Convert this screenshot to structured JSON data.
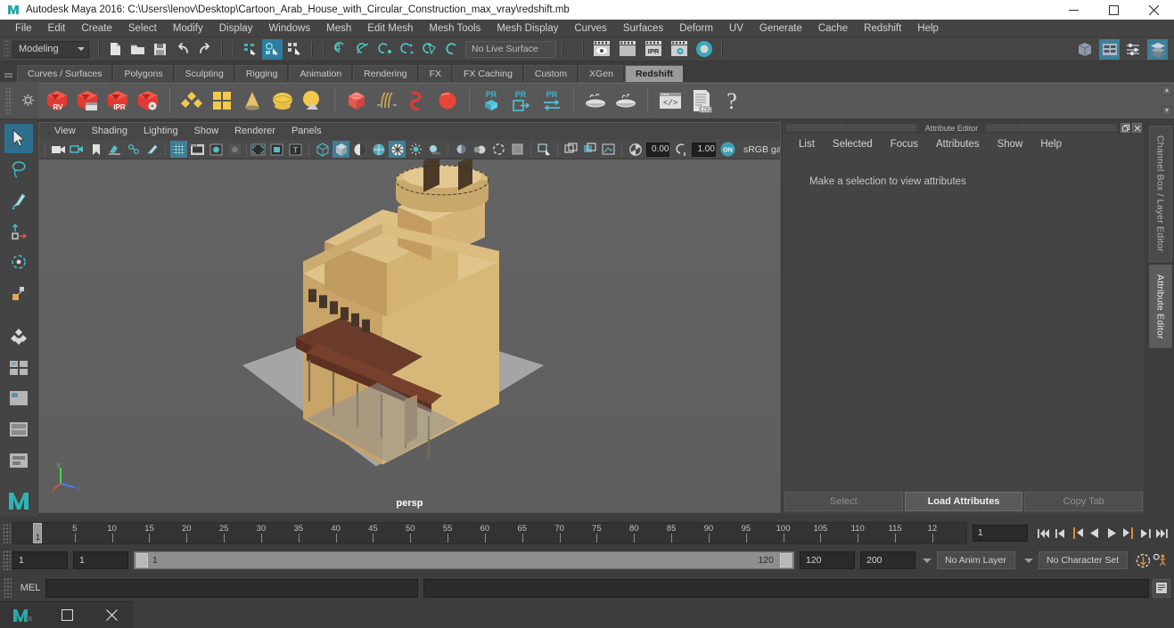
{
  "window": {
    "title": "Autodesk Maya 2016: C:\\Users\\lenov\\Desktop\\Cartoon_Arab_House_with_Circular_Construction_max_vray\\redshift.mb",
    "minimize": "─",
    "maximize": "❐",
    "close": "✕"
  },
  "menubar": {
    "items": [
      {
        "label": "File"
      },
      {
        "label": "Edit"
      },
      {
        "label": "Create"
      },
      {
        "label": "Select"
      },
      {
        "label": "Modify"
      },
      {
        "label": "Display"
      },
      {
        "label": "Windows"
      },
      {
        "label": "Mesh"
      },
      {
        "label": "Edit Mesh"
      },
      {
        "label": "Mesh Tools"
      },
      {
        "label": "Mesh Display"
      },
      {
        "label": "Curves"
      },
      {
        "label": "Surfaces"
      },
      {
        "label": "Deform"
      },
      {
        "label": "UV"
      },
      {
        "label": "Generate"
      },
      {
        "label": "Cache"
      },
      {
        "label": "Redshift"
      },
      {
        "label": "Help"
      }
    ]
  },
  "statusline": {
    "mode": "Modeling",
    "live_surface": "No Live Surface",
    "icons": {
      "new_scene": "new-scene-icon",
      "open_scene": "open-scene-icon",
      "save_scene": "save-scene-icon",
      "undo": "undo-icon",
      "redo": "redo-icon",
      "select_hierarchy": "select-by-hierarchy-icon",
      "select_object": "select-by-object-type-icon",
      "select_component": "select-by-component-type-icon",
      "snap_grid": "snap-to-grid-icon",
      "snap_curve": "snap-to-curve-icon",
      "snap_point": "snap-to-point-icon",
      "snap_projected": "snap-to-projected-center-icon",
      "snap_view_plane": "snap-to-view-plane-icon",
      "make_live": "make-live-icon",
      "render_current": "render-current-frame-icon",
      "render_sequence": "render-sequence-icon",
      "ipr_render": "ipr-render-icon",
      "render_settings": "render-settings-icon",
      "render_view": "render-view-icon",
      "show_hide_modeling": "toggle-modeling-editors-icon",
      "show_hide_attribute": "toggle-attribute-editor-icon",
      "show_hide_tool": "toggle-tool-settings-icon",
      "show_hide_channel": "toggle-channel-box-icon"
    }
  },
  "shelf": {
    "tabs": [
      {
        "label": "Curves / Surfaces",
        "active": false
      },
      {
        "label": "Polygons",
        "active": false
      },
      {
        "label": "Sculpting",
        "active": false
      },
      {
        "label": "Rigging",
        "active": false
      },
      {
        "label": "Animation",
        "active": false
      },
      {
        "label": "Rendering",
        "active": false
      },
      {
        "label": "FX",
        "active": false
      },
      {
        "label": "FX Caching",
        "active": false
      },
      {
        "label": "Custom",
        "active": false
      },
      {
        "label": "XGen",
        "active": false
      },
      {
        "label": "Redshift",
        "active": true
      }
    ],
    "buttons": [
      {
        "name": "redshift-render-view-icon",
        "badge": "RV"
      },
      {
        "name": "redshift-render-sequence-icon",
        "badge": ""
      },
      {
        "name": "redshift-ipr-icon",
        "badge": "IPR"
      },
      {
        "name": "redshift-render-settings-icon",
        "badge": ""
      },
      {
        "name": "redshift-material-icon",
        "badge": ""
      },
      {
        "name": "redshift-subsurface-icon",
        "badge": ""
      },
      {
        "name": "redshift-light-cone-icon",
        "badge": ""
      },
      {
        "name": "redshift-dome-light-icon",
        "badge": ""
      },
      {
        "name": "redshift-environment-icon",
        "badge": ""
      },
      {
        "name": "redshift-proxy-icon",
        "badge": ""
      },
      {
        "name": "redshift-hair-icon",
        "badge": ""
      },
      {
        "name": "redshift-curve-icon",
        "badge": ""
      },
      {
        "name": "redshift-sphere-icon",
        "badge": ""
      },
      {
        "name": "redshift-pr-object-icon",
        "badge": "PR"
      },
      {
        "name": "redshift-pr-export-icon",
        "badge": "PR"
      },
      {
        "name": "redshift-pr-transfer-icon",
        "badge": "PR"
      },
      {
        "name": "redshift-volume-icon",
        "badge": ""
      },
      {
        "name": "redshift-volume2-icon",
        "badge": ""
      },
      {
        "name": "redshift-script-editor-icon",
        "badge": ""
      },
      {
        "name": "redshift-log-icon",
        "badge": "LOG"
      },
      {
        "name": "redshift-help-icon",
        "badge": "?"
      }
    ]
  },
  "toolbox": {
    "tools": [
      {
        "name": "select-tool",
        "selected": true
      },
      {
        "name": "lasso-select-tool",
        "selected": false
      },
      {
        "name": "paint-select-tool",
        "selected": false
      },
      {
        "name": "move-tool",
        "selected": false
      },
      {
        "name": "rotate-tool",
        "selected": false
      },
      {
        "name": "scale-tool",
        "selected": false
      },
      {
        "name": "last-tool-used",
        "selected": false
      },
      {
        "name": "show-manipulator-tool",
        "selected": false
      },
      {
        "name": "single-perspective-layout",
        "selected": false
      },
      {
        "name": "four-view-layout",
        "selected": false
      },
      {
        "name": "persp-outliner-layout",
        "selected": false
      },
      {
        "name": "hypergraph-layout",
        "selected": false
      },
      {
        "name": "maya-logo",
        "selected": false
      }
    ]
  },
  "viewport": {
    "menus": [
      {
        "label": "View"
      },
      {
        "label": "Shading"
      },
      {
        "label": "Lighting"
      },
      {
        "label": "Show"
      },
      {
        "label": "Renderer"
      },
      {
        "label": "Panels"
      }
    ],
    "camera_label": "persp",
    "exposure": "0.00",
    "gamma_value": "1.00",
    "gamma_label": "sRGB gamma",
    "axis_labels": {
      "x": "x",
      "y": "y",
      "z": "z"
    },
    "toolbar_icons": [
      "select-camera-icon",
      "camera-attributes-icon",
      "bookmark-icon",
      "image-plane-icon",
      "two-d-pan-zoom-icon",
      "grease-pencil-icon",
      "grid-toggle-icon",
      "film-gate-icon",
      "resolution-gate-icon",
      "gate-mask-icon",
      "film-origin-icon",
      "safe-action-icon",
      "title-safe-icon",
      "wireframe-shading-icon",
      "smooth-shade-all-icon",
      "smooth-shade-flat-icon",
      "wireframe-on-shaded-icon",
      "textured-shading-icon",
      "use-default-light-icon",
      "shadows-icon",
      "screen-space-ao-icon",
      "motion-blur-icon",
      "multisample-icon",
      "isolate-select-icon",
      "xray-icon",
      "xray-joints-icon",
      "xray-active-components-icon",
      "exposure-icon",
      "gamma-icon",
      "color-management-toggle-icon"
    ]
  },
  "attribute_editor": {
    "panel_title": "Attribute Editor",
    "menus": [
      {
        "label": "List"
      },
      {
        "label": "Selected"
      },
      {
        "label": "Focus"
      },
      {
        "label": "Attributes"
      },
      {
        "label": "Show"
      },
      {
        "label": "Help"
      }
    ],
    "empty_message": "Make a selection to view attributes",
    "footer_buttons": [
      {
        "label": "Select",
        "primary": false
      },
      {
        "label": "Load Attributes",
        "primary": true
      },
      {
        "label": "Copy Tab",
        "primary": false
      }
    ],
    "undock_icon": "undock-icon",
    "close_icon": "close-icon"
  },
  "vertical_tabs": [
    {
      "label": "Channel Box / Layer Editor",
      "active": false
    },
    {
      "label": "Attribute Editor",
      "active": true
    }
  ],
  "timeline": {
    "tick_labels": [
      "5",
      "10",
      "15",
      "20",
      "25",
      "30",
      "35",
      "40",
      "45",
      "50",
      "55",
      "60",
      "65",
      "70",
      "75",
      "80",
      "85",
      "90",
      "95",
      "100",
      "105",
      "110",
      "115",
      "12"
    ],
    "start": 1,
    "end": 120,
    "current_frame": "1",
    "playhead_label": "1",
    "current_frame_field": "1",
    "playback_buttons": [
      {
        "name": "go-to-start-button",
        "glyph": "⏮"
      },
      {
        "name": "step-back-frame-button",
        "glyph": "⏴"
      },
      {
        "name": "step-back-key-button",
        "glyph": "⏴"
      },
      {
        "name": "play-backwards-button",
        "glyph": "◀"
      },
      {
        "name": "play-forwards-button",
        "glyph": "▶"
      },
      {
        "name": "step-forward-key-button",
        "glyph": "⏵"
      },
      {
        "name": "step-forward-frame-button",
        "glyph": "⏵"
      },
      {
        "name": "go-to-end-button",
        "glyph": "⏭"
      }
    ]
  },
  "range_slider": {
    "anim_start": "1",
    "playback_start": "1",
    "range_start_label": "1",
    "range_end_label": "120",
    "playback_end": "120",
    "anim_end": "200",
    "anim_layer": "No Anim Layer",
    "character_set": "No Character Set",
    "auto_key_icon": "auto-keyframe-icon",
    "anim_prefs_icon": "animation-preferences-icon"
  },
  "command_line": {
    "label": "MEL",
    "input_value": "",
    "output_value": "",
    "script_editor_icon": "script-editor-icon"
  },
  "taskbar": {
    "items": [
      {
        "name": "taskbar-maya-icon",
        "label": ""
      },
      {
        "name": "taskbar-maximize-icon",
        "label": "□"
      },
      {
        "name": "taskbar-close-icon",
        "label": "✕"
      }
    ]
  },
  "colors": {
    "accent_teal": "#3f9fb5",
    "accent_blue": "#2f7c9e",
    "redshift_red": "#e03030",
    "shelf_yellow": "#f0c24a",
    "orange": "#e07b2a"
  }
}
